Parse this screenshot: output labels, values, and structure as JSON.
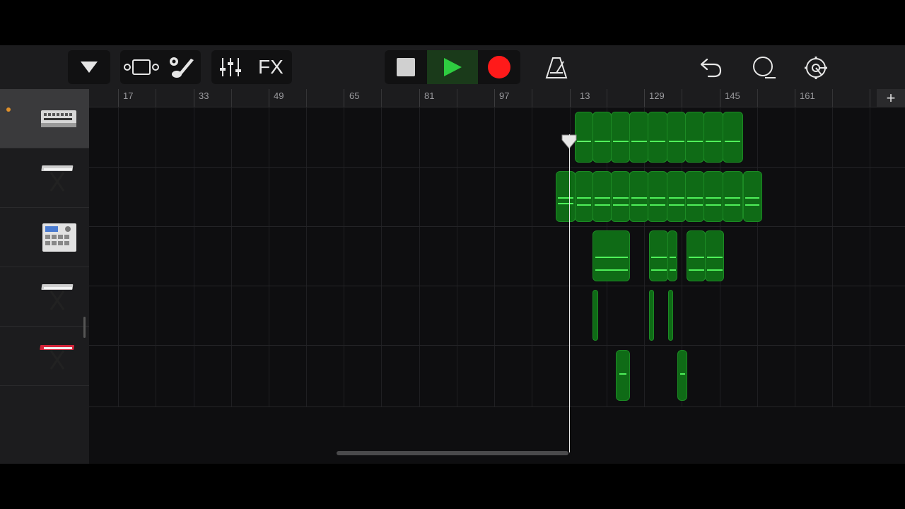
{
  "toolbar": {
    "fx_label": "FX",
    "accent_play": "#2ecc40",
    "record_color": "#ff1a1a"
  },
  "ruler": {
    "labels": [
      "17",
      "33",
      "49",
      "65",
      "81",
      "97",
      "13",
      "129",
      "145",
      "161"
    ],
    "add_label": "+"
  },
  "tracks": [
    {
      "instrument": "drum-machine-icon",
      "selected": true
    },
    {
      "instrument": "keyboard-stand-icon",
      "selected": false
    },
    {
      "instrument": "beat-sampler-icon",
      "selected": false
    },
    {
      "instrument": "keyboard-stand-icon",
      "selected": false
    },
    {
      "instrument": "red-synth-keyboard-icon",
      "selected": false
    }
  ],
  "add_track_label": "+"
}
